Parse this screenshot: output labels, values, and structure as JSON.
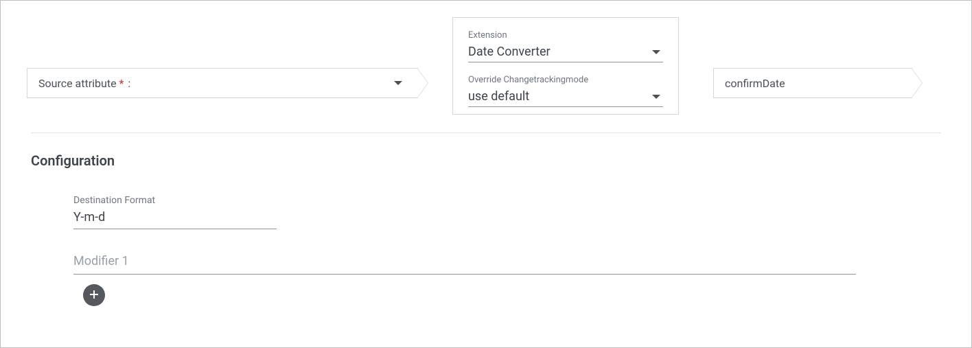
{
  "source": {
    "label": "Source attribute",
    "required_marker": "*",
    "colon": ":"
  },
  "extension": {
    "label": "Extension",
    "value": "Date Converter",
    "override_label": "Override Changetrackingmode",
    "override_value": "use default"
  },
  "destination": {
    "value": "confirmDate"
  },
  "config": {
    "heading": "Configuration",
    "format_label": "Destination Format",
    "format_value": "Y-m-d",
    "modifier_placeholder": "Modifier 1"
  }
}
